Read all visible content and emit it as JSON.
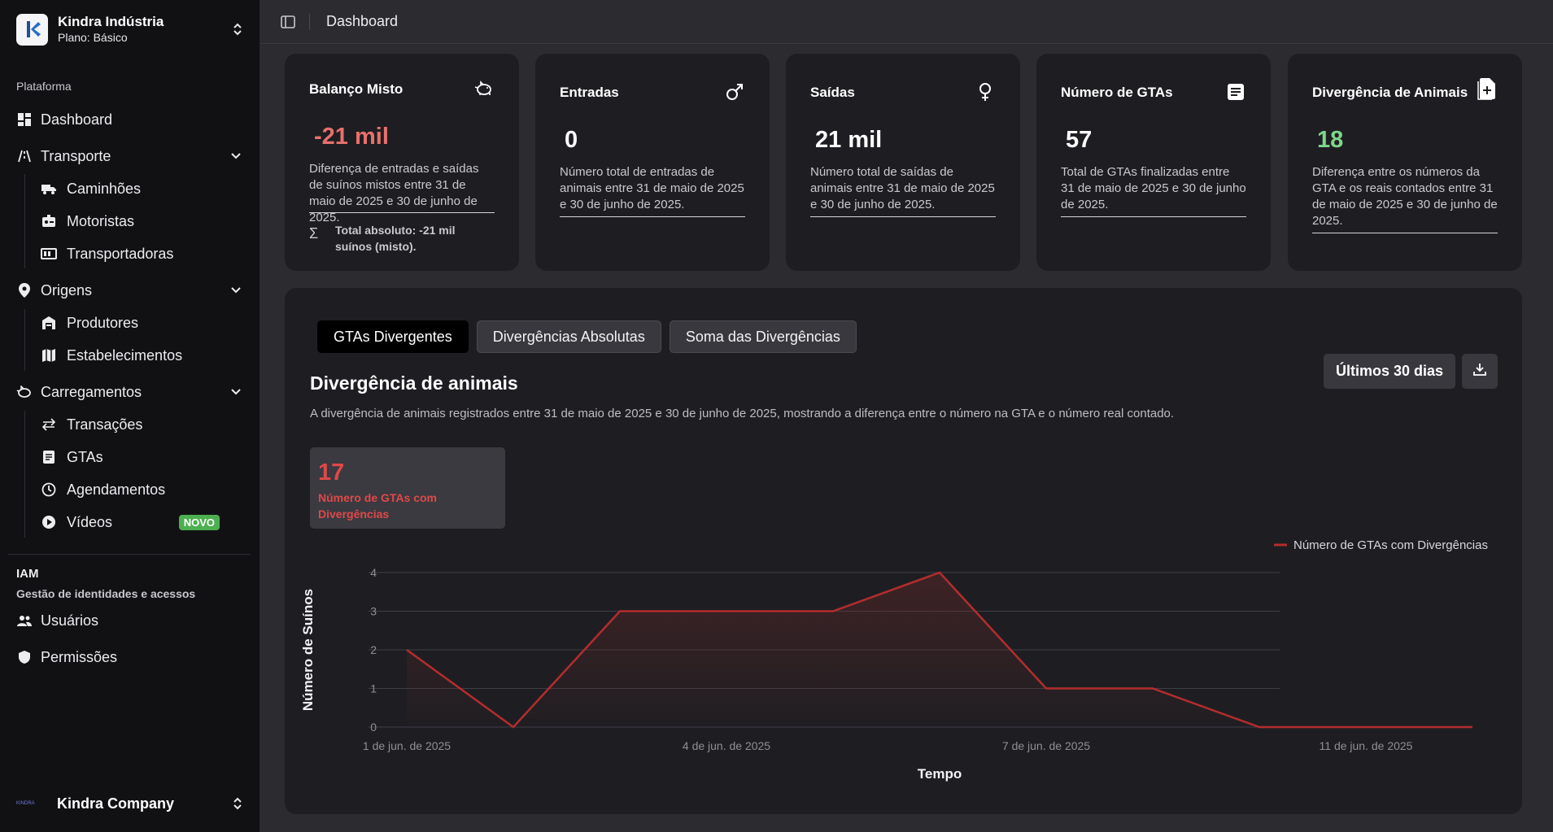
{
  "sidebar": {
    "org": {
      "name": "Kindra Indústria",
      "plan": "Plano: Básico"
    },
    "platform_label": "Plataforma",
    "dashboard": "Dashboard",
    "transporte": {
      "label": "Transporte",
      "items": [
        "Caminhões",
        "Motoristas",
        "Transportadoras"
      ]
    },
    "origens": {
      "label": "Origens",
      "items": [
        "Produtores",
        "Estabelecimentos"
      ]
    },
    "carregamentos": {
      "label": "Carregamentos",
      "items": [
        "Transações",
        "GTAs",
        "Agendamentos",
        "Vídeos"
      ]
    },
    "novo_badge": "NOVO",
    "iam": {
      "title": "IAM",
      "subtitle": "Gestão de identidades e acessos",
      "items": [
        "Usuários",
        "Permissões"
      ]
    },
    "company": {
      "name": "Kindra Company",
      "logo_text": "KINDRA"
    }
  },
  "topbar": {
    "breadcrumb": "Dashboard"
  },
  "cards": [
    {
      "title": "Balanço Misto",
      "icon": "piggy-bank-icon",
      "value": "-21 mil",
      "value_color": "#e8706c",
      "desc": "Diferença de entradas e saídas de suínos mistos entre 31 de maio de 2025 e 30 de junho de 2025.",
      "total": "Total absoluto: -21 mil suínos (misto)."
    },
    {
      "title": "Entradas",
      "icon": "male-icon",
      "value": "0",
      "value_color": "#ffffff",
      "desc": "Número total de entradas de animais entre 31 de maio de 2025 e 30 de junho de 2025."
    },
    {
      "title": "Saídas",
      "icon": "female-icon",
      "value": "21 mil",
      "value_color": "#ffffff",
      "desc": "Número total de saídas de animais entre 31 de maio de 2025 e 30 de junho de 2025."
    },
    {
      "title": "Número de GTAs",
      "icon": "document-icon",
      "value": "57",
      "value_color": "#ffffff",
      "desc": "Total de GTAs finalizadas entre 31 de maio de 2025 e 30 de junho de 2025."
    },
    {
      "title": "Divergência de Animais",
      "icon": "note-add-icon",
      "value": "18",
      "value_color": "#7fd68a",
      "desc": "Diferença entre os números da GTA e os reais contados entre 31 de maio de 2025 e 30 de junho de 2025."
    }
  ],
  "panel": {
    "tabs": [
      "GTAs Divergentes",
      "Divergências Absolutas",
      "Soma das Divergências"
    ],
    "active_tab": 0,
    "title": "Divergência de animais",
    "description": "A divergência de animais registrados entre 31 de maio de 2025 e 30 de junho de 2025, mostrando a diferença entre o número na GTA e o número real contado.",
    "range_button": "Últimos 30 dias",
    "stat": {
      "value": "17",
      "label": "Número de GTAs com Divergências"
    }
  },
  "chart_data": {
    "type": "area",
    "x": [
      1,
      2,
      3,
      4,
      5,
      6,
      7,
      8,
      9,
      10,
      11
    ],
    "x_tick_labels": {
      "1": "1 de jun. de 2025",
      "4": "4 de jun. de 2025",
      "7": "7 de jun. de 2025",
      "10": "11 de jun. de 2025"
    },
    "series": [
      {
        "name": "Número de GTAs com Divergências",
        "values": [
          2,
          0,
          3,
          3,
          3,
          4,
          1,
          1,
          0,
          0,
          0
        ],
        "color": "#b32d2d"
      }
    ],
    "y_ticks": [
      0,
      1,
      2,
      3,
      4
    ],
    "ylim": [
      0,
      4
    ],
    "xlabel": "Tempo",
    "ylabel": "Número de Suínos",
    "legend": "top-right",
    "grid": true
  }
}
